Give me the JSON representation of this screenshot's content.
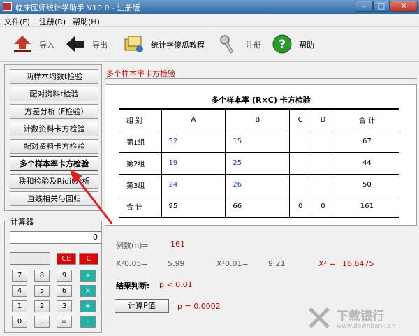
{
  "window": {
    "title": "临床医师统计学助手 V10.0 - 注册版",
    "min_label": "–",
    "max_label": "□",
    "close_label": "✕"
  },
  "menu": [
    "文件(F)",
    "注册(R)",
    "帮助(H)"
  ],
  "toolbar": {
    "import": "导入",
    "export": "导出",
    "tutorial": "统计学傻瓜教程",
    "register": "注册",
    "help": "帮助"
  },
  "sidebar": {
    "items": [
      {
        "label": "两样本均数t检验"
      },
      {
        "label": "配对资料t检验"
      },
      {
        "label": "方差分析 (F检验)"
      },
      {
        "label": "计数资料卡方检验"
      },
      {
        "label": "配对资料卡方检验"
      },
      {
        "label": "多个样本率卡方检验"
      },
      {
        "label": "秩和检验及Ridit分析"
      },
      {
        "label": "直线相关与回归"
      }
    ]
  },
  "calculator": {
    "title": "计算器",
    "display": "0",
    "keys": {
      "ce": "CE",
      "c": "C",
      "k7": "7",
      "k8": "8",
      "k9": "9",
      "div": "÷",
      "k4": "4",
      "k5": "5",
      "k6": "6",
      "mul": "×",
      "k1": "1",
      "k2": "2",
      "k3": "3",
      "add": "+",
      "k0": "0",
      "dot": ".",
      "eq": "=",
      "sub": "-"
    }
  },
  "tab_label": "多个样本率卡方检验",
  "table": {
    "title": "多个样本率 (R×C) 卡方检验",
    "header": [
      "组  别",
      "A",
      "B",
      "C",
      "D",
      "合  计"
    ],
    "rows": [
      {
        "label": "第1组",
        "cells": [
          "52",
          "15",
          "",
          "",
          "67"
        ]
      },
      {
        "label": "第2组",
        "cells": [
          "19",
          "25",
          "",
          "",
          "44"
        ]
      },
      {
        "label": "第3组",
        "cells": [
          "24",
          "26",
          "",
          "",
          "50"
        ]
      },
      {
        "label": "合  计",
        "cells": [
          "95",
          "66",
          "0",
          "0",
          "161"
        ]
      }
    ]
  },
  "results": {
    "n_label": "例数(n)=",
    "n_value": "161",
    "crit05_label": "X²0.05=",
    "crit05_value": "5.99",
    "crit01_label": "X²0.01=",
    "crit01_value": "9.21",
    "chi_label": "X² =",
    "chi_value": "16.6475",
    "judgement_label": "结果判断:",
    "judgement_value": "p < 0.01",
    "calc_button": "计算P值",
    "p_value": "p = 0.0002"
  },
  "watermark": {
    "brand": "下载银行",
    "url": "www.downbank.cn"
  },
  "colors": {
    "accent_red": "#d00000",
    "blue_values": "#1a3fd0",
    "calc_red": "#e00000",
    "calc_teal": "#1fb3a6"
  }
}
